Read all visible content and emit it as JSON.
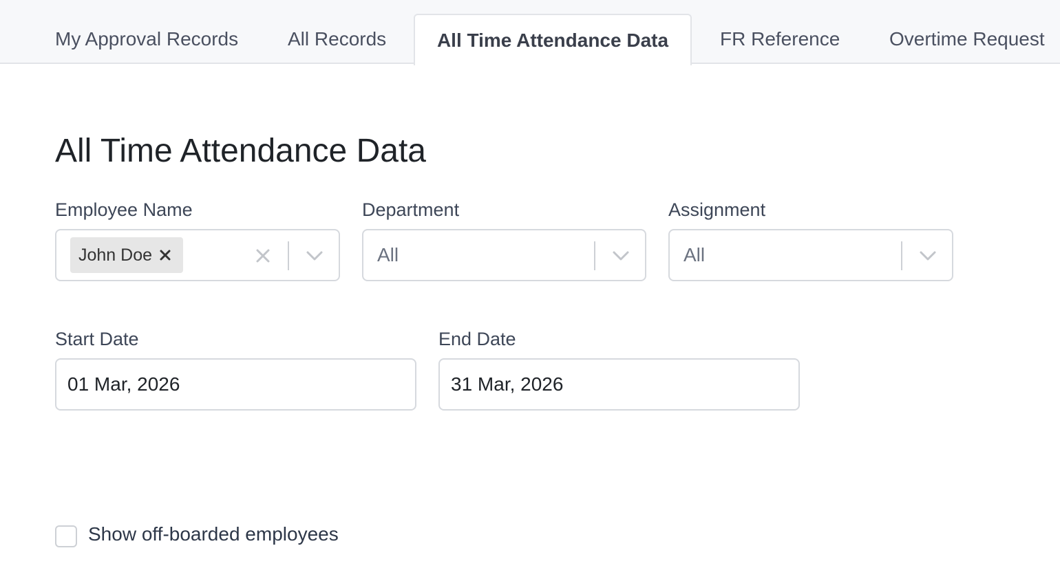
{
  "tabs": [
    {
      "label": "My Approval Records",
      "active": false
    },
    {
      "label": "All Records",
      "active": false
    },
    {
      "label": "All Time Attendance Data",
      "active": true
    },
    {
      "label": "FR Reference",
      "active": false
    },
    {
      "label": "Overtime Request",
      "active": false
    }
  ],
  "page": {
    "title": "All Time Attendance Data"
  },
  "filters": {
    "employee": {
      "label": "Employee Name",
      "selected_chip": "John Doe"
    },
    "department": {
      "label": "Department",
      "value": "All"
    },
    "assignment": {
      "label": "Assignment",
      "value": "All"
    },
    "start_date": {
      "label": "Start Date",
      "value": "01 Mar, 2026"
    },
    "end_date": {
      "label": "End Date",
      "value": "31 Mar, 2026"
    }
  },
  "offboarded": {
    "label": "Show off-boarded employees",
    "checked": false
  },
  "icons": {
    "chip_remove": "close-icon",
    "clear": "clear-icon",
    "dropdown": "chevron-down-icon"
  }
}
